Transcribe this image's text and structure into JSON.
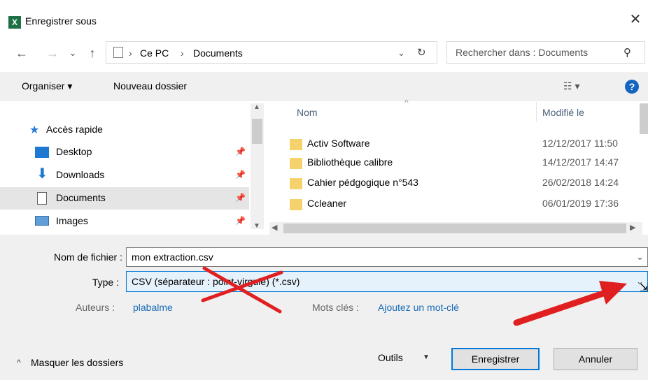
{
  "window": {
    "title": "Enregistrer sous",
    "app_icon": "X",
    "close_glyph": "✕"
  },
  "nav_buttons": {
    "back": "←",
    "forward": "→",
    "recent": "⌄",
    "up": "↑"
  },
  "address": {
    "crumbs": [
      "Ce PC",
      "Documents"
    ],
    "separator": "›",
    "refresh": "↻"
  },
  "search": {
    "placeholder": "Rechercher dans : Documents"
  },
  "toolbar": {
    "organize": "Organiser ▾",
    "new_folder": "Nouveau dossier",
    "view": "☷ ▾",
    "help": "?"
  },
  "sidebar": {
    "quick_access": "Accès rapide",
    "items": [
      {
        "label": "Desktop",
        "icon": "desktop-icon"
      },
      {
        "label": "Downloads",
        "icon": "downloads-icon"
      },
      {
        "label": "Documents",
        "icon": "documents-icon"
      },
      {
        "label": "Images",
        "icon": "images-icon"
      }
    ]
  },
  "file_list": {
    "columns": {
      "name": "Nom",
      "modified": "Modifié le"
    },
    "rows": [
      {
        "name": "Activ Software",
        "date": "12/12/2017 11:50"
      },
      {
        "name": "Bibliothèque calibre",
        "date": "14/12/2017 14:47"
      },
      {
        "name": "Cahier pédgogique n°543",
        "date": "26/02/2018 14:24"
      },
      {
        "name": "Ccleaner",
        "date": "06/01/2019 17:36"
      }
    ]
  },
  "form": {
    "filename_label": "Nom de fichier :",
    "filename_value": "mon extraction.csv",
    "type_label": "Type :",
    "type_value": "CSV (séparateur : point-virgule) (*.csv)",
    "authors_label": "Auteurs :",
    "authors_value": "plabalme",
    "tags_label": "Mots clés :",
    "tags_value": "Ajoutez un mot-clé"
  },
  "footer": {
    "hide_folders": "Masquer les dossiers",
    "tools": "Outils",
    "save": "Enregistrer",
    "cancel": "Annuler"
  },
  "colors": {
    "annotation": "#e02020",
    "accent": "#0078d7",
    "link": "#1a6cb8"
  }
}
